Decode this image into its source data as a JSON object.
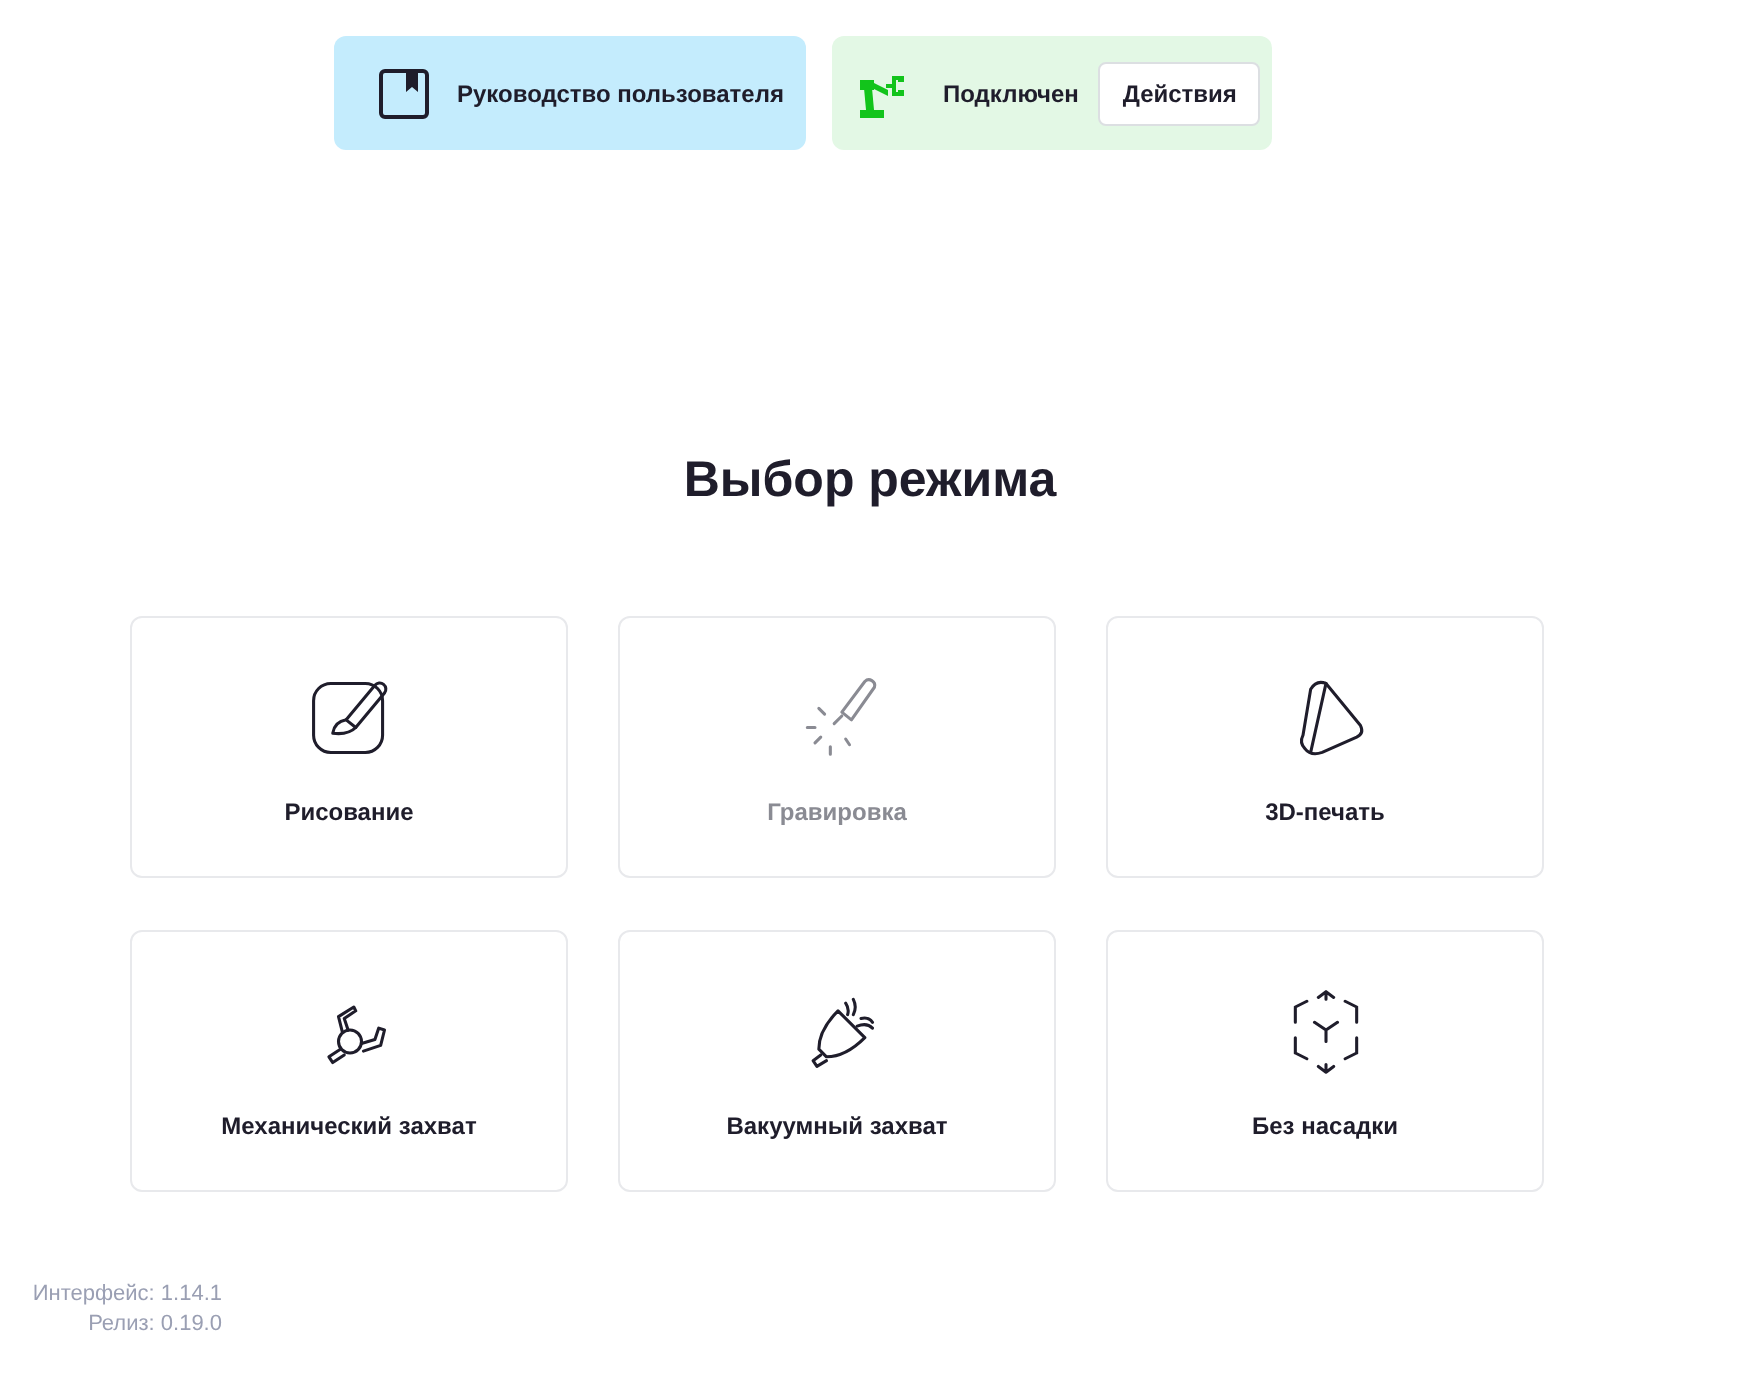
{
  "header": {
    "manual": {
      "label": "Руководство пользователя"
    },
    "robot": {
      "status": "Подключен",
      "connected": true,
      "action": "Действия"
    }
  },
  "title": "Выбор режима",
  "modes": [
    {
      "kind": "drawing",
      "label": "Рисование",
      "disabled": false
    },
    {
      "kind": "engraving",
      "label": "Гравировка",
      "disabled": true
    },
    {
      "kind": "printing",
      "label": "3D-печать",
      "disabled": false
    },
    {
      "kind": "gripper",
      "label": "Механический захват",
      "disabled": false
    },
    {
      "kind": "vacuum",
      "label": "Вакуумный захват",
      "disabled": false
    },
    {
      "kind": "none",
      "label": "Без насадки",
      "disabled": false
    }
  ],
  "footer": [
    "Интерфейс: 1.14.1",
    "Релиз: 0.19.0"
  ]
}
